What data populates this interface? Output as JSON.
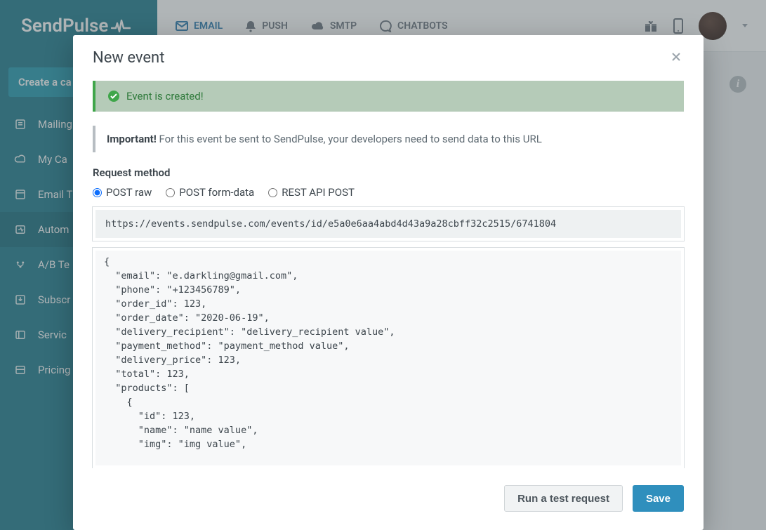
{
  "brand": "SendPulse",
  "sidebar": {
    "create_label": "Create a ca",
    "items": [
      {
        "label": "Mailing"
      },
      {
        "label": "My Ca"
      },
      {
        "label": "Email T"
      },
      {
        "label": "Autom"
      },
      {
        "label": "A/B Te"
      },
      {
        "label": "Subscr"
      },
      {
        "label": "Servic"
      },
      {
        "label": "Pricing"
      }
    ],
    "active_index": 3
  },
  "topnav": {
    "tabs": [
      {
        "key": "email",
        "label": "EMAIL"
      },
      {
        "key": "push",
        "label": "PUSH"
      },
      {
        "key": "smtp",
        "label": "SMTP"
      },
      {
        "key": "chatbots",
        "label": "CHATBOTS"
      }
    ]
  },
  "modal": {
    "title": "New event",
    "success_msg": "Event is created!",
    "important_label": "Important!",
    "important_text": " For this event be sent to SendPulse, your developers need to send data to this URL",
    "method_label": "Request method",
    "methods": [
      {
        "key": "post_raw",
        "label": "POST raw",
        "checked": true
      },
      {
        "key": "post_form",
        "label": "POST form-data",
        "checked": false
      },
      {
        "key": "rest_api",
        "label": "REST API POST",
        "checked": false
      }
    ],
    "url": "https://events.sendpulse.com/events/id/e5a0e6aa4abd4d43a9a28cbff32c2515/6741804",
    "payload": "{\n  \"email\": \"e.darkling@gmail.com\",\n  \"phone\": \"+123456789\",\n  \"order_id\": 123,\n  \"order_date\": \"2020-06-19\",\n  \"delivery_recipient\": \"delivery_recipient value\",\n  \"payment_method\": \"payment_method value\",\n  \"delivery_price\": 123,\n  \"total\": 123,\n  \"products\": [\n    {\n      \"id\": 123,\n      \"name\": \"name value\",\n      \"img\": \"img value\",\n",
    "buttons": {
      "run_test": "Run a test request",
      "save": "Save"
    }
  },
  "colors": {
    "primary": "#2f8fbd",
    "success": "#3fa64a",
    "sidebar": "#1e7a8c"
  }
}
